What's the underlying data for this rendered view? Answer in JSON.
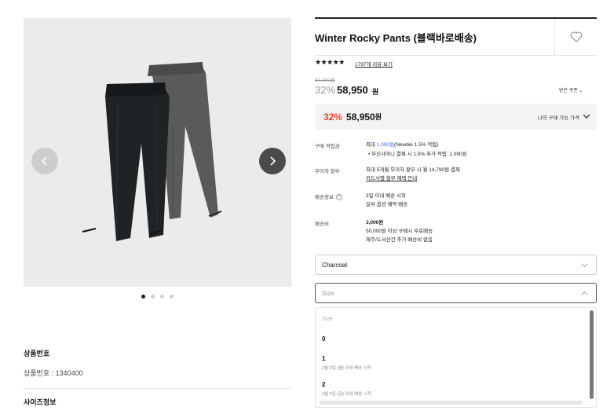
{
  "gallery": {
    "prev_icon": "chevron-left-icon",
    "next_icon": "chevron-right-icon",
    "slide_count": 4,
    "active_slide": 1
  },
  "info": {
    "product_no_title": "상품번호",
    "product_no_text": "상품번호 : 1340400",
    "size_info_title": "사이즈정보"
  },
  "product": {
    "name": "Winter Rocky Pants (블랙바로배송)",
    "wishlist_icon": "heart-icon",
    "rating_stars": "★★★★★",
    "review_link": "1797개 리뷰 보기",
    "original_price": "87,000원",
    "discount": "32%",
    "sale_price": "58,950",
    "price_unit": "원",
    "coupon_button": "받은 쿠폰 ⌄"
  },
  "my_price": {
    "discount": "32%",
    "price": "58,950",
    "unit": "원",
    "label": "나의 구매 가능 가격"
  },
  "details": {
    "points_label": "구매 적립금",
    "points_prefix": "최대 ",
    "points_amount": "1,090원",
    "points_suffix": "(Newbie 1.5% 적립)",
    "points_note": "•  무신사머니 결제 시 1.5% 추가 적립: 1,090원",
    "installment_label": "무이자 할부",
    "installment_text": "최대 5개월 무이자 할부 시 월 14,790원 결제",
    "installment_link": "카드사별 할부 혜택 안내",
    "shipping_label": "배송정보",
    "shipping_text1": "3일 이내 배송 시작",
    "shipping_text2": "일부 옵션 예약 배송",
    "fee_label": "배송비",
    "fee_amount": "3,000원",
    "fee_text1": "50,000원 이상 구매시 무료배송",
    "fee_text2": "제주/도서산간 추가 배송비 없음"
  },
  "options": {
    "color_value": "Charcoal",
    "size_placeholder": "Size",
    "dropdown_header": "Size",
    "size_options": [
      {
        "label": "0",
        "sub": ""
      },
      {
        "label": "1",
        "sub": "2월 9일 (월) 이내 배송 시작"
      },
      {
        "label": "2",
        "sub": "2월 6일 (금) 이내 배송 시작"
      }
    ]
  },
  "colors": {
    "accent_red": "#ff3b30",
    "link_blue": "#2f6fec"
  }
}
